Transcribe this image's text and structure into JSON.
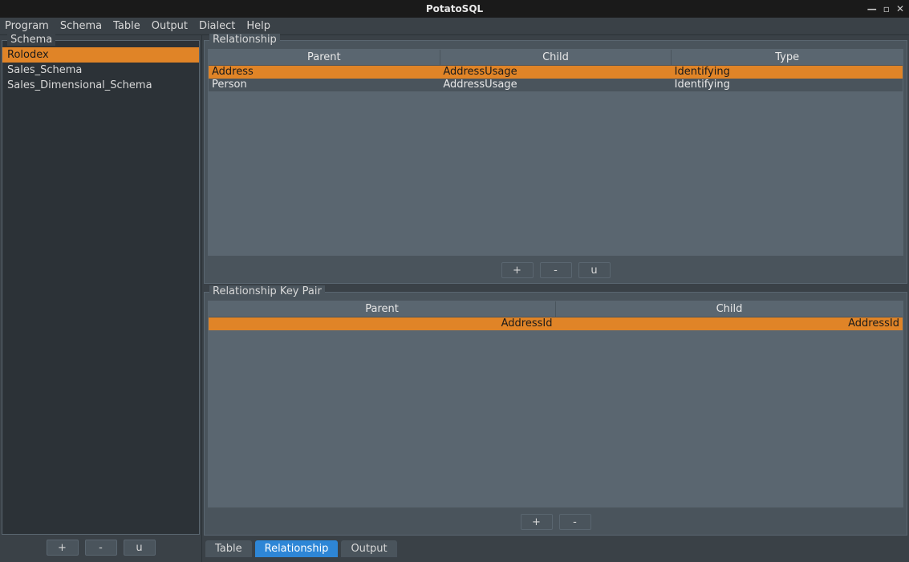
{
  "app_title": "PotatoSQL",
  "menu": [
    "Program",
    "Schema",
    "Table",
    "Output",
    "Dialect",
    "Help"
  ],
  "sidebar": {
    "title": "Schema",
    "items": [
      {
        "label": "Rolodex",
        "selected": true
      },
      {
        "label": "Sales_Schema",
        "selected": false
      },
      {
        "label": "Sales_Dimensional_Schema",
        "selected": false
      }
    ],
    "buttons": {
      "add": "+",
      "remove": "-",
      "update": "u"
    }
  },
  "relationship_panel": {
    "title": "Relationship",
    "headers": [
      "Parent",
      "Child",
      "Type"
    ],
    "rows": [
      {
        "parent": "Address",
        "child": "AddressUsage",
        "type": "Identifying",
        "selected": true
      },
      {
        "parent": "Person",
        "child": "AddressUsage",
        "type": "Identifying",
        "selected": false
      }
    ],
    "buttons": {
      "add": "+",
      "remove": "-",
      "update": "u"
    }
  },
  "keypair_panel": {
    "title": "Relationship Key Pair",
    "headers": [
      "Parent",
      "Child"
    ],
    "rows": [
      {
        "parent": "AddressId",
        "child": "AddressId",
        "selected": true
      }
    ],
    "buttons": {
      "add": "+",
      "remove": "-"
    }
  },
  "tabs": [
    {
      "label": "Table",
      "active": false
    },
    {
      "label": "Relationship",
      "active": true
    },
    {
      "label": "Output",
      "active": false
    }
  ]
}
